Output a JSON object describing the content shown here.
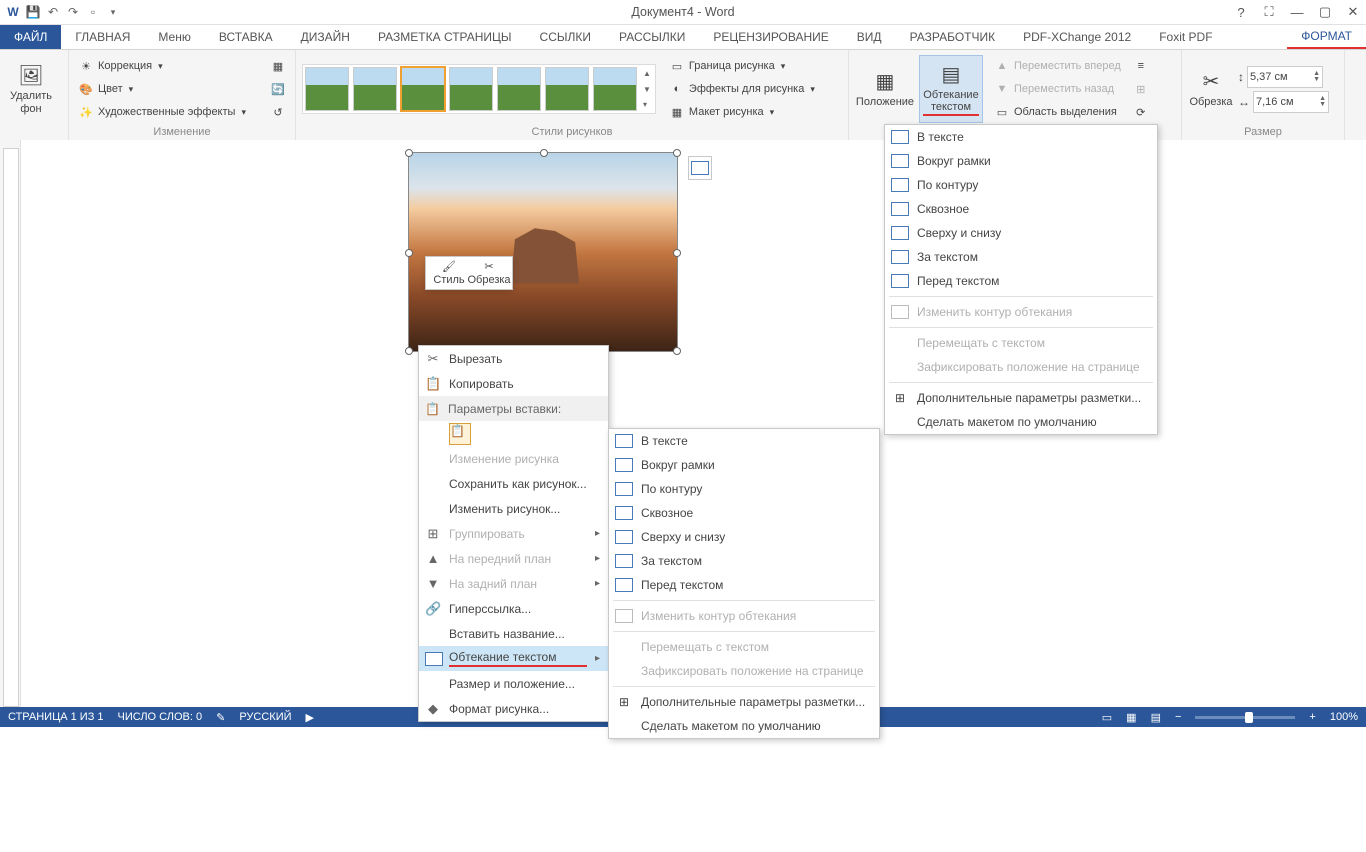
{
  "app": {
    "title": "Документ4 - Word"
  },
  "tabs": {
    "file": "ФАЙЛ",
    "items": [
      "ГЛАВНАЯ",
      "Меню",
      "ВСТАВКА",
      "ДИЗАЙН",
      "РАЗМЕТКА СТРАНИЦЫ",
      "ССЫЛКИ",
      "РАССЫЛКИ",
      "РЕЦЕНЗИРОВАНИЕ",
      "ВИД",
      "РАЗРАБОТЧИК",
      "PDF-XChange 2012",
      "Foxit PDF"
    ],
    "active": "ФОРМАТ"
  },
  "ribbon": {
    "remove_bg": {
      "label": "Удалить\nфон"
    },
    "adjust": {
      "correction": "Коррекция",
      "color": "Цвет",
      "effects": "Художественные эффекты",
      "group_label": "Изменение"
    },
    "styles": {
      "border": "Граница рисунка",
      "effects": "Эффекты для рисунка",
      "layout": "Макет рисунка",
      "group_label": "Стили рисунков"
    },
    "arrange": {
      "position": "Положение",
      "wrap": "Обтекание\nтекстом",
      "forward": "Переместить вперед",
      "backward": "Переместить назад",
      "selection": "Область выделения"
    },
    "crop": {
      "label": "Обрезка",
      "group_label": "Размер"
    },
    "size": {
      "h": "5,37 см",
      "w": "7,16 см"
    }
  },
  "mini_toolbar": {
    "style": "Стиль",
    "crop": "Обрезка"
  },
  "context_menu": {
    "cut": "Вырезать",
    "copy": "Копировать",
    "paste_header": "Параметры вставки:",
    "change_pic": "Изменение рисунка",
    "save_as_pic": "Сохранить как рисунок...",
    "edit_pic": "Изменить рисунок...",
    "group": "Группировать",
    "bring_front": "На передний план",
    "send_back": "На задний план",
    "hyperlink": "Гиперссылка...",
    "insert_caption": "Вставить название...",
    "wrap_text": "Обтекание текстом",
    "size_pos": "Размер и положение...",
    "format_pic": "Формат рисунка..."
  },
  "wrap_menu": {
    "in_text": "В тексте",
    "square": "Вокруг рамки",
    "tight": "По контуру",
    "through": "Сквозное",
    "top_bottom": "Сверху и снизу",
    "behind": "За текстом",
    "front": "Перед текстом",
    "edit_points": "Изменить контур обтекания",
    "move_with": "Перемещать с текстом",
    "fix_pos": "Зафиксировать положение на странице",
    "more": "Дополнительные параметры разметки...",
    "default": "Сделать макетом по умолчанию"
  },
  "statusbar": {
    "page": "СТРАНИЦА 1 ИЗ 1",
    "words": "ЧИСЛО СЛОВ: 0",
    "lang": "РУССКИЙ",
    "zoom": "100%"
  }
}
